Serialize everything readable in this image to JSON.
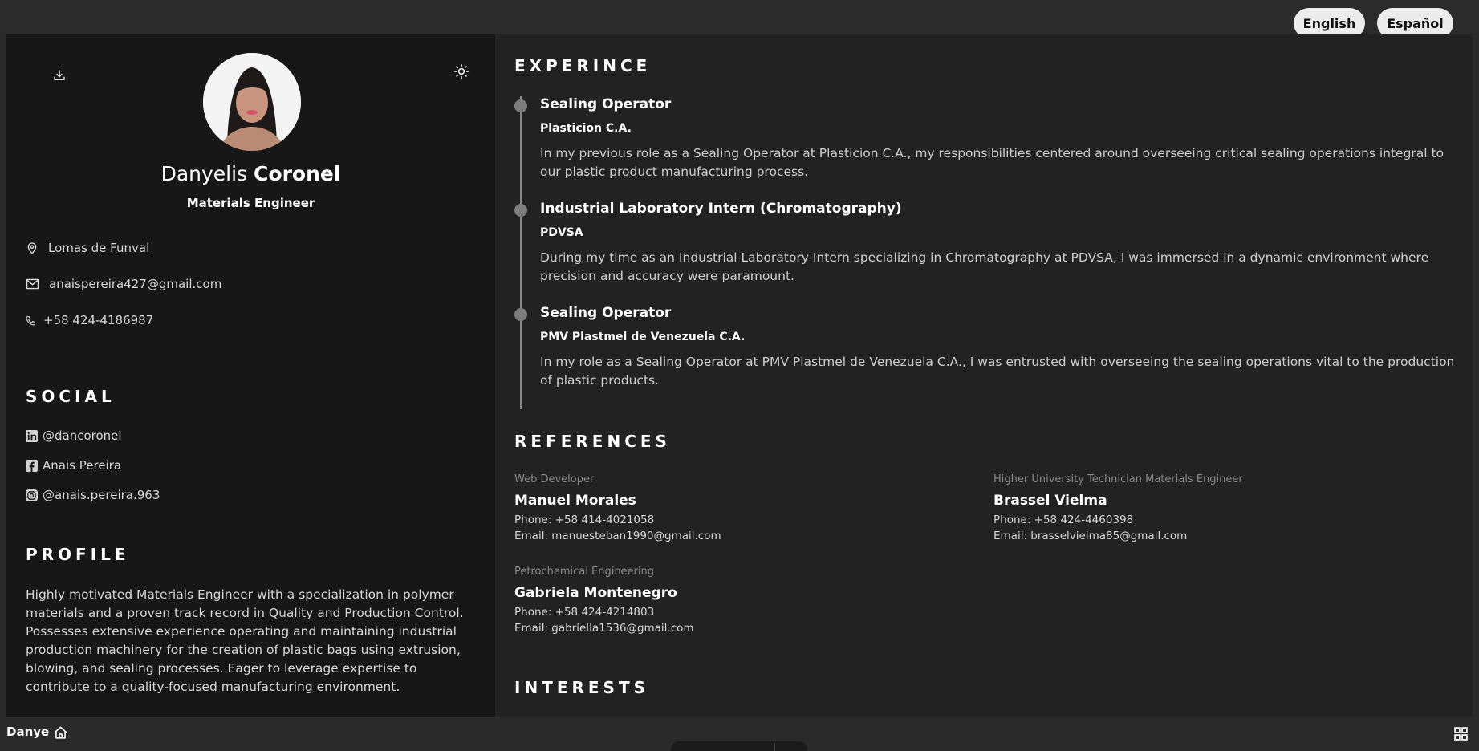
{
  "language_switcher": {
    "english": "English",
    "spanish": "Español"
  },
  "sidebar": {
    "name_first": "Danyelis",
    "name_last": "Coronel",
    "title": "Materials Engineer",
    "contact": {
      "location": "Lomas de Funval",
      "email": "anaispereira427@gmail.com",
      "phone": "+58 424-4186987"
    },
    "social_heading": "SOCIAL",
    "social": {
      "linkedin": "@dancoronel",
      "facebook": "Anais Pereira",
      "instagram": "@anais.pereira.963"
    },
    "profile_heading": "PROFILE",
    "profile_text": "Highly motivated Materials Engineer with a specialization in polymer materials and a proven track record in Quality and Production Control. Possesses extensive experience operating and maintaining industrial production machinery for the creation of plastic bags using extrusion, blowing, and sealing processes. Eager to leverage expertise to contribute to a quality-focused manufacturing environment."
  },
  "experience": {
    "heading": "EXPERINCE",
    "items": [
      {
        "title": "Sealing Operator",
        "company": "Plasticion C.A.",
        "description": "In my previous role as a Sealing Operator at Plasticion C.A., my responsibilities centered around overseeing critical sealing operations integral to our plastic product manufacturing process."
      },
      {
        "title": "Industrial Laboratory Intern (Chromatography)",
        "company": "PDVSA",
        "description": "During my time as an Industrial Laboratory Intern specializing in Chromatography at PDVSA, I was immersed in a dynamic environment where precision and accuracy were paramount."
      },
      {
        "title": "Sealing Operator",
        "company": "PMV Plastmel de Venezuela C.A.",
        "description": "In my role as a Sealing Operator at PMV Plastmel de Venezuela C.A., I was entrusted with overseeing the sealing operations vital to the production of plastic products."
      }
    ]
  },
  "references": {
    "heading": "REFERENCES",
    "items": [
      {
        "role": "Web Developer",
        "name": "Manuel Morales",
        "phone": "Phone: +58 414-4021058",
        "email": "Email: manuesteban1990@gmail.com"
      },
      {
        "role": "Higher University Technician Materials Engineer",
        "name": "Brassel Vielma",
        "phone": "Phone: +58 424-4460398",
        "email": "Email: brasselvielma85@gmail.com"
      },
      {
        "role": "Petrochemical Engineering",
        "name": "Gabriela Montenegro",
        "phone": "Phone: +58 424-4214803",
        "email": "Email: gabriella1536@gmail.com"
      }
    ]
  },
  "interests": {
    "heading": "INTERESTS"
  },
  "bottom_bar": {
    "label": "Danye"
  },
  "colors": {
    "sidebar_bg": "#181718",
    "main_bg": "#222222",
    "accent_dot": "#7d7d7d"
  },
  "icons": [
    "download-icon",
    "sun-icon",
    "map-pin-icon",
    "mail-icon",
    "phone-icon",
    "linkedin-icon",
    "facebook-icon",
    "instagram-icon",
    "home-icon",
    "grid-icon"
  ]
}
